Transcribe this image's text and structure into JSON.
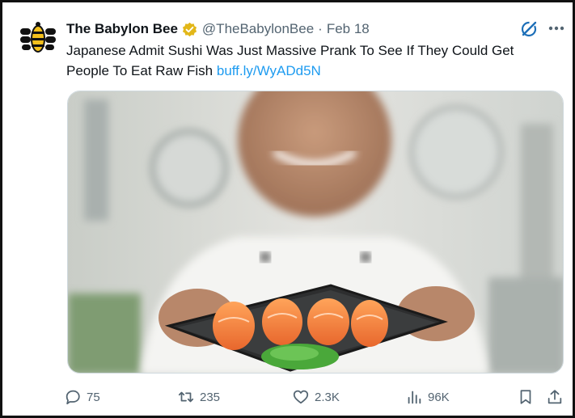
{
  "tweet": {
    "author_name": "The Babylon Bee",
    "handle": "@TheBabylonBee",
    "separator": "·",
    "date": "Feb 18",
    "text": "Japanese Admit Sushi Was Just Massive Prank To See If They Could Get People To Eat Raw Fish",
    "link": "buff.ly/WyADd5N",
    "media_icon": "photo-chef-holding-sushi-plate"
  },
  "actions": {
    "replies": "75",
    "reposts": "235",
    "likes": "2.3K",
    "views": "96K"
  },
  "icons": [
    "babylon-bee-logo",
    "verified-badge-icon",
    "grok-icon",
    "more-icon",
    "reply-icon",
    "repost-icon",
    "like-icon",
    "views-icon",
    "bookmark-icon",
    "share-icon"
  ],
  "colors": {
    "text": "#0f1419",
    "secondary": "#536471",
    "link": "#1d9bf0",
    "verified_gold": "#e2b719",
    "logo_yellow": "#f3c01c"
  }
}
